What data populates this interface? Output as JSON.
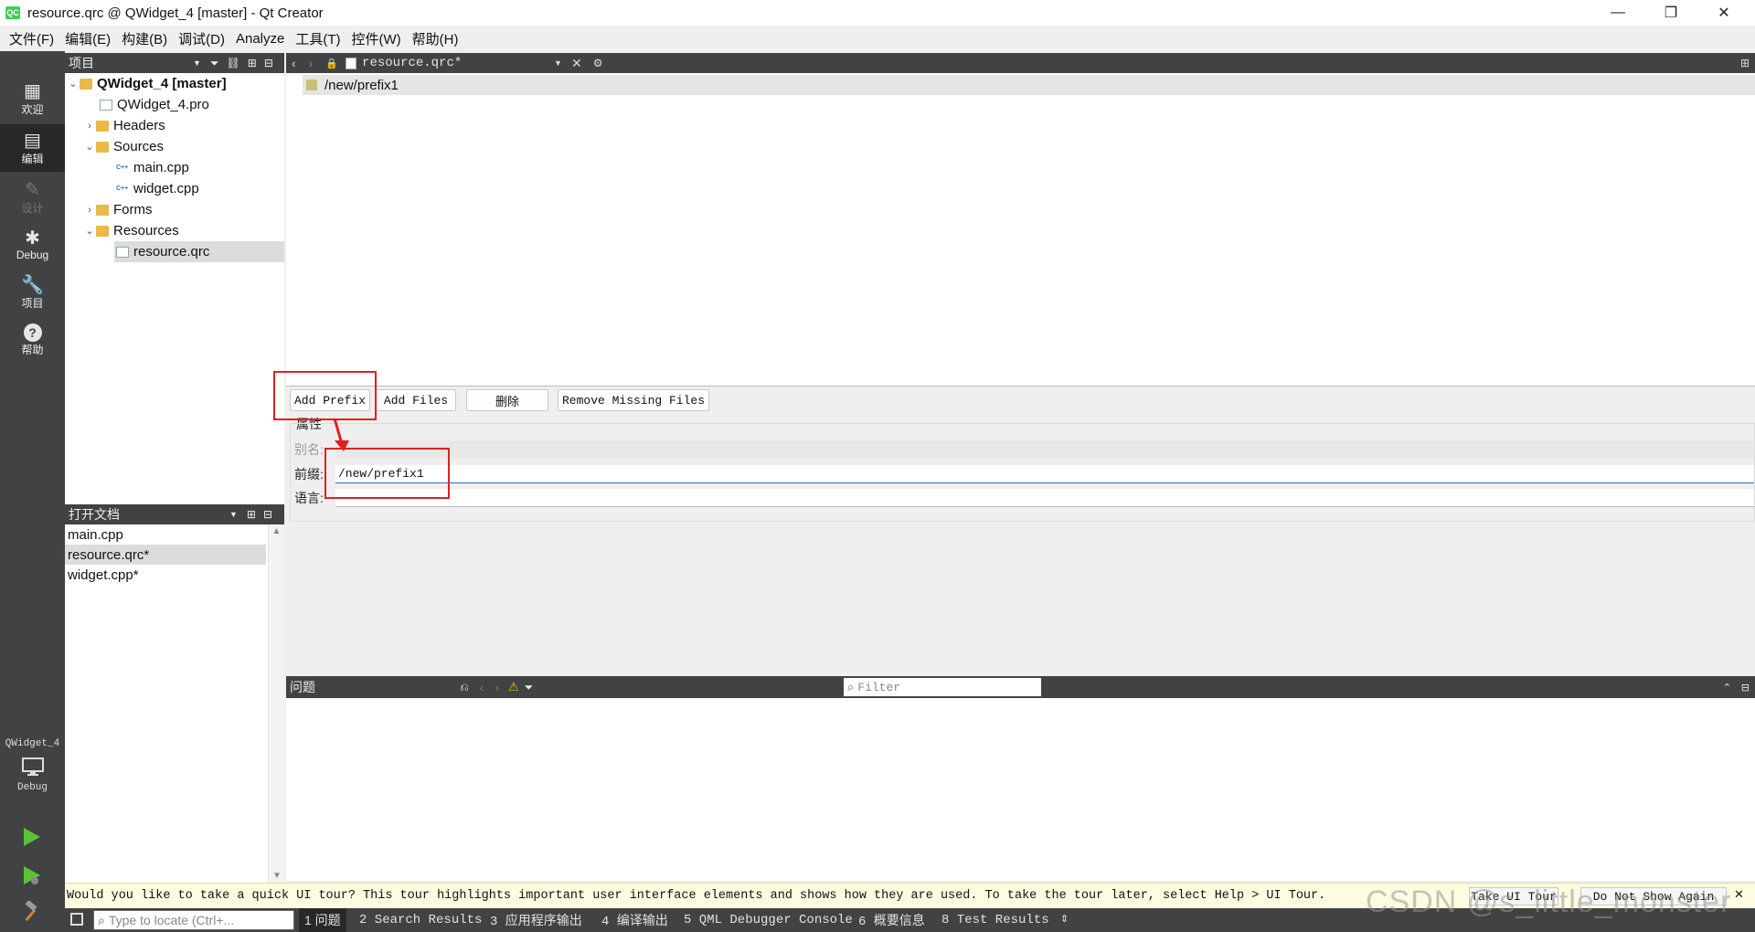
{
  "window": {
    "title": "resource.qrc @ QWidget_4 [master] - Qt Creator",
    "app_icon": "QC"
  },
  "menu": [
    "文件(F)",
    "编辑(E)",
    "构建(B)",
    "调试(D)",
    "Analyze",
    "工具(T)",
    "控件(W)",
    "帮助(H)"
  ],
  "modes": [
    {
      "label": "欢迎",
      "icon": "▦"
    },
    {
      "label": "编辑",
      "icon": "▤"
    },
    {
      "label": "设计",
      "icon": "✎"
    },
    {
      "label": "Debug",
      "icon": "✱"
    },
    {
      "label": "项目",
      "icon": "🔧"
    },
    {
      "label": "帮助",
      "icon": "?"
    }
  ],
  "kit": {
    "project": "QWidget_4",
    "config": "Debug"
  },
  "project_pane": {
    "title": "项目",
    "tree": [
      {
        "label": "QWidget_4 [master]"
      },
      {
        "label": "QWidget_4.pro"
      },
      {
        "label": "Headers"
      },
      {
        "label": "Sources"
      },
      {
        "label": "main.cpp"
      },
      {
        "label": "widget.cpp"
      },
      {
        "label": "Forms"
      },
      {
        "label": "Resources"
      },
      {
        "label": "resource.qrc"
      }
    ]
  },
  "open_docs": {
    "title": "打开文档",
    "items": [
      "main.cpp",
      "resource.qrc*",
      "widget.cpp*"
    ]
  },
  "editor": {
    "file_tab": "resource.qrc*",
    "prefix_entry": "/new/prefix1",
    "buttons": {
      "add_prefix": "Add Prefix",
      "add_files": "Add Files",
      "delete": "删除",
      "remove_missing": "Remove Missing Files"
    },
    "properties": {
      "group_title": "属性",
      "alias_label": "别名:",
      "alias_value": "",
      "prefix_label": "前缀:",
      "prefix_value": "/new/prefix1",
      "language_label": "语言:",
      "language_value": ""
    }
  },
  "issues": {
    "title": "问题",
    "filter_placeholder": "Filter"
  },
  "tour": {
    "message": "Would you like to take a quick UI tour? This tour highlights important user interface elements and shows how they are used. To take the tour later, select Help > UI Tour.",
    "take_button": "Take UI Tour",
    "dismiss_button": "Do Not Show Again"
  },
  "statusbar": {
    "locator_placeholder": "Type to locate (Ctrl+...",
    "tabs": [
      "1 问题",
      "2 Search Results",
      "3 应用程序输出",
      "4 编译输出",
      "5 QML Debugger Console",
      "6 概要信息",
      "8 Test Results"
    ]
  },
  "watermark": "CSDN @s_little_monster",
  "colors": {
    "sidebar": "#404244",
    "selected": "#262829",
    "annotation_red": "#e02020",
    "tour_bg": "#fffbe0"
  }
}
